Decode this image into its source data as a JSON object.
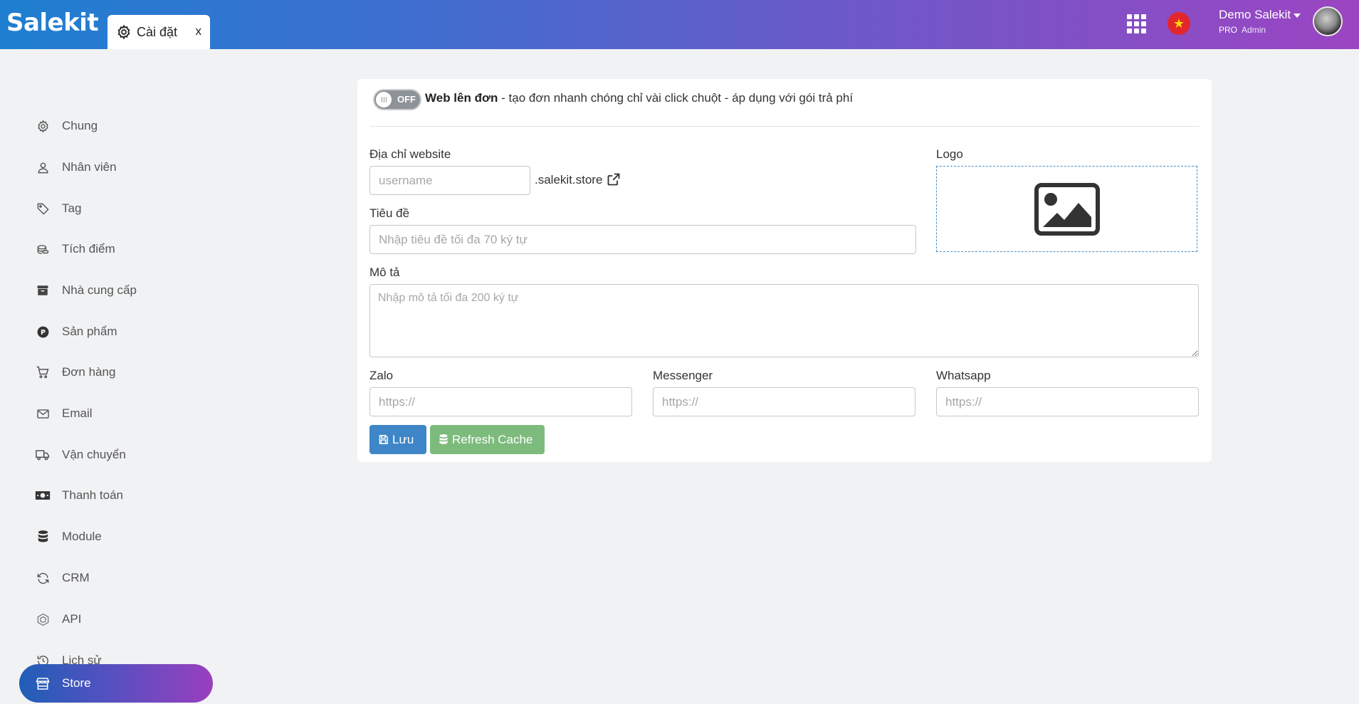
{
  "header": {
    "app_name": "Salekit",
    "tab": {
      "label": "Cài đặt",
      "close": "x"
    },
    "user": {
      "name": "Demo Salekit",
      "plan": "PRO",
      "role": "Admin"
    },
    "flag_star": "★"
  },
  "sidebar": {
    "items": [
      {
        "label": "Chung",
        "icon": "gear-icon"
      },
      {
        "label": "Nhân viên",
        "icon": "user-icon"
      },
      {
        "label": "Tag",
        "icon": "tag-icon"
      },
      {
        "label": "Tích điểm",
        "icon": "coins-icon"
      },
      {
        "label": "Nhà cung cấp",
        "icon": "archive-icon"
      },
      {
        "label": "Sản phẩm",
        "icon": "product-icon"
      },
      {
        "label": "Đơn hàng",
        "icon": "cart-icon"
      },
      {
        "label": "Email",
        "icon": "mail-icon"
      },
      {
        "label": "Vận chuyển",
        "icon": "truck-icon"
      },
      {
        "label": "Thanh toán",
        "icon": "money-icon"
      },
      {
        "label": "Module",
        "icon": "database-icon"
      },
      {
        "label": "CRM",
        "icon": "sync-icon"
      },
      {
        "label": "API",
        "icon": "api-icon"
      },
      {
        "label": "Lịch sử",
        "icon": "history-icon"
      },
      {
        "label": "Store",
        "icon": "store-icon",
        "active": true
      }
    ]
  },
  "store_settings": {
    "toggle": {
      "state": "OFF"
    },
    "headline": {
      "title": "Web lên đơn",
      "description": " - tạo đơn nhanh chóng chỉ vài click chuột  - áp dụng với gói trả phí"
    },
    "website": {
      "label": "Địa chỉ website",
      "placeholder": "username",
      "suffix": ".salekit.store"
    },
    "logo": {
      "label": "Logo"
    },
    "title_field": {
      "label": "Tiêu đề",
      "placeholder": "Nhập tiêu đề tối đa 70 ký tự"
    },
    "description_field": {
      "label": "Mô tả",
      "placeholder": "Nhập mô tả tối đa 200 ký tự"
    },
    "zalo": {
      "label": "Zalo",
      "placeholder": "https://"
    },
    "messenger": {
      "label": "Messenger",
      "placeholder": "https://"
    },
    "whatsapp": {
      "label": "Whatsapp",
      "placeholder": "https://"
    },
    "buttons": {
      "save": "Lưu",
      "refresh_cache": "Refresh Cache"
    }
  },
  "colors": {
    "header_gradient_start": "#1e7fd0",
    "header_gradient_end": "#9b45c2",
    "save_button": "#3e86c8",
    "refresh_button": "#7cbb7c",
    "toggle_off": "#8e9399"
  }
}
